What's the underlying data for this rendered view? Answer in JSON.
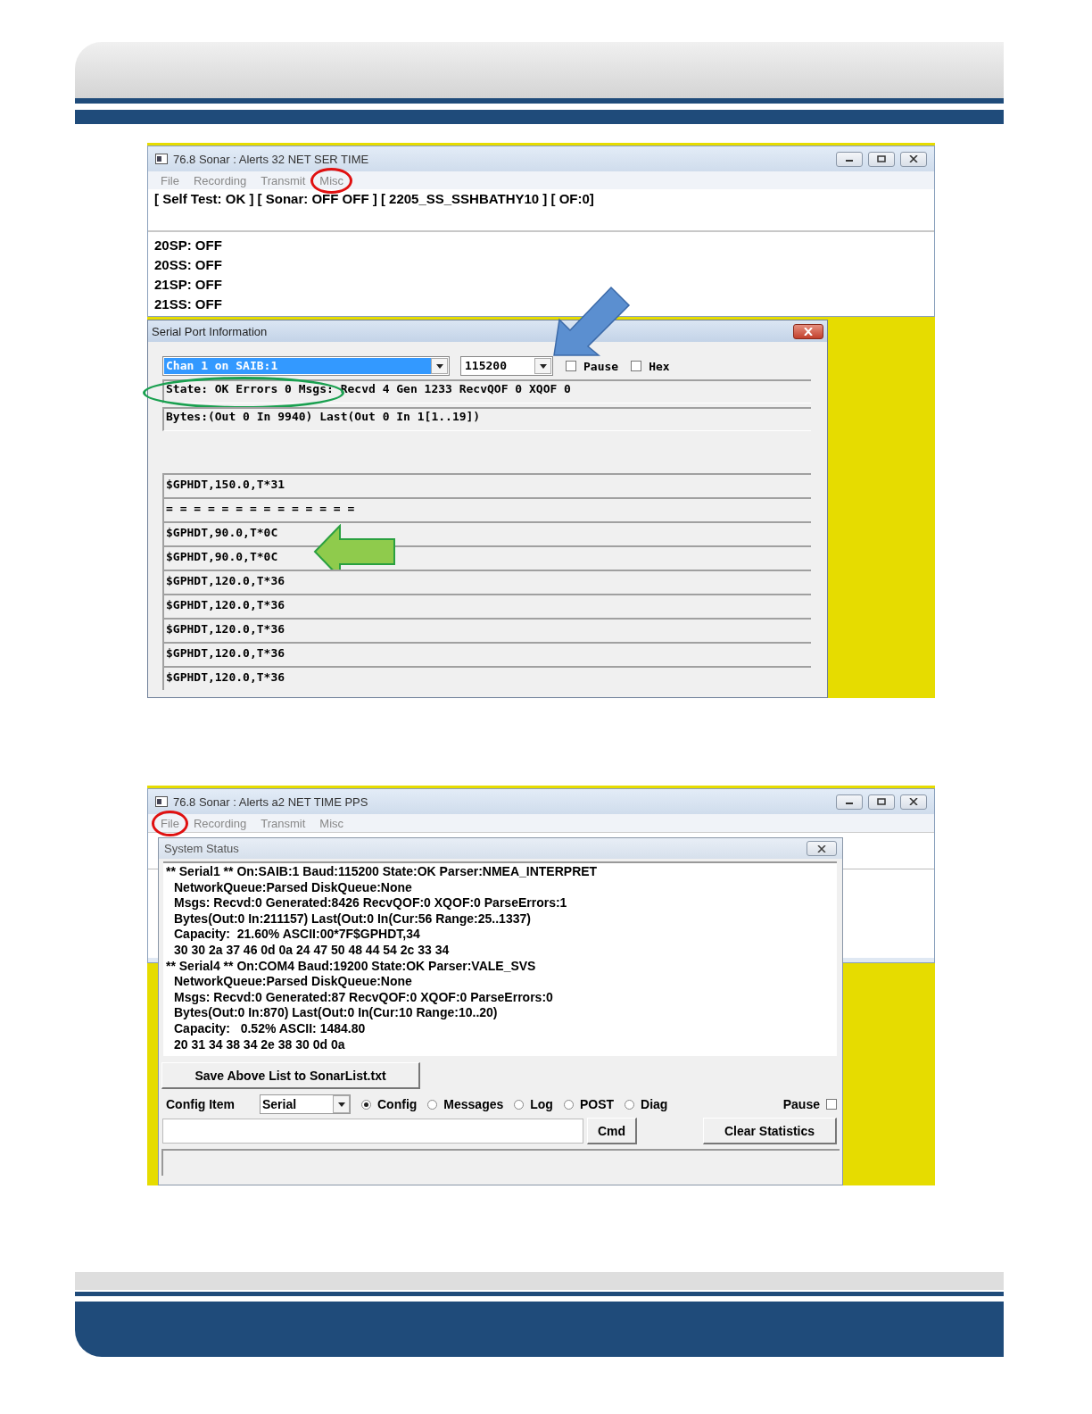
{
  "figure_1": {
    "window": {
      "title": "76.8 Sonar : Alerts 32 NET SER TIME",
      "menu": [
        {
          "label": "File",
          "circled": false
        },
        {
          "label": "Recording",
          "circled": false
        },
        {
          "label": "Transmit",
          "circled": false
        },
        {
          "label": "Misc",
          "circled": true
        }
      ],
      "status_line": "[ Self Test: OK ] [ Sonar: OFF OFF ] [ 2205_SS_SSHBATHY10 ] [ OF:0]",
      "lines": [
        "20SP: OFF",
        "20SS: OFF",
        "21SP: OFF",
        "21SS: OFF"
      ]
    },
    "serial_dialog": {
      "title": "Serial Port Information",
      "channel": "Chan 1 on SAIB:1",
      "baud": "115200",
      "baud_arrow": true,
      "checkboxes": [
        {
          "label": "Pause",
          "checked": false
        },
        {
          "label": "Hex",
          "checked": false
        }
      ],
      "info_lines": [
        {
          "text": "State: OK Errors 0 Msgs: Recvd 4 Gen 1233 RecvQOF 0 XQOF 0",
          "circled": true
        },
        {
          "text": "Bytes:(Out 0 In 9940) Last(Out 0 In 1[1..19])",
          "circled": false
        }
      ],
      "messages": [
        {
          "text": "$GPHDT,150.0,T*31",
          "arrow": false
        },
        {
          "text": "= = = = = = = = = = = = = =",
          "arrow": false
        },
        {
          "text": "$GPHDT,90.0,T*0C",
          "arrow": false
        },
        {
          "text": "$GPHDT,90.0,T*0C",
          "arrow": true
        },
        {
          "text": "$GPHDT,120.0,T*36",
          "arrow": false
        },
        {
          "text": "$GPHDT,120.0,T*36",
          "arrow": false
        },
        {
          "text": "$GPHDT,120.0,T*36",
          "arrow": false
        },
        {
          "text": "$GPHDT,120.0,T*36",
          "arrow": false
        },
        {
          "text": "$GPHDT,120.0,T*36",
          "arrow": false
        }
      ]
    }
  },
  "figure_2": {
    "window": {
      "title": "76.8 Sonar : Alerts a2 NET TIME PPS",
      "menu": [
        {
          "label": "File",
          "circled": true
        },
        {
          "label": "Recording",
          "circled": false
        },
        {
          "label": "Transmit",
          "circled": false
        },
        {
          "label": "Misc",
          "circled": false
        }
      ]
    },
    "system_status": {
      "title": "System Status",
      "lines": [
        {
          "kind": "header",
          "text": "** Serial1 ** On:SAIB:1 Baud:115200 State:OK Parser:NMEA_INTERPRET"
        },
        {
          "kind": "detail",
          "text": "NetworkQueue:Parsed DiskQueue:None"
        },
        {
          "kind": "detail",
          "text": "Msgs: Recvd:0 Generated:8426 RecvQOF:0 XQOF:0 ParseErrors:1"
        },
        {
          "kind": "detail",
          "text": "Bytes(Out:0 In:211157) Last(Out:0 In(Cur:56 Range:25..1337)"
        },
        {
          "kind": "detail",
          "text": "Capacity:  21.60% ASCII:00*7F$GPHDT,34"
        },
        {
          "kind": "detail",
          "text": "30 30 2a 37 46 0d 0a 24 47 50 48 44 54 2c 33 34"
        },
        {
          "kind": "header",
          "text": "** Serial4 ** On:COM4 Baud:19200 State:OK Parser:VALE_SVS"
        },
        {
          "kind": "detail",
          "text": "NetworkQueue:Parsed DiskQueue:None"
        },
        {
          "kind": "detail",
          "text": "Msgs: Recvd:0 Generated:87 RecvQOF:0 XQOF:0 ParseErrors:0"
        },
        {
          "kind": "detail",
          "text": "Bytes(Out:0 In:870) Last(Out:0 In(Cur:10 Range:10..20)"
        },
        {
          "kind": "detail",
          "text": "Capacity:   0.52% ASCII: 1484.80"
        },
        {
          "kind": "detail",
          "text": "20 31 34 38 34 2e 38 30 0d 0a"
        }
      ],
      "save_button": "Save Above List to SonarList.txt",
      "config_label": "Config Item",
      "config_select": "Serial",
      "radios": [
        {
          "label": "Config",
          "selected": true
        },
        {
          "label": "Messages",
          "selected": false
        },
        {
          "label": "Log",
          "selected": false
        },
        {
          "label": "POST",
          "selected": false
        },
        {
          "label": "Diag",
          "selected": false
        }
      ],
      "pause": {
        "label": "Pause",
        "checked": false
      },
      "cmd_button": "Cmd",
      "clear_button": "Clear Statistics"
    }
  }
}
